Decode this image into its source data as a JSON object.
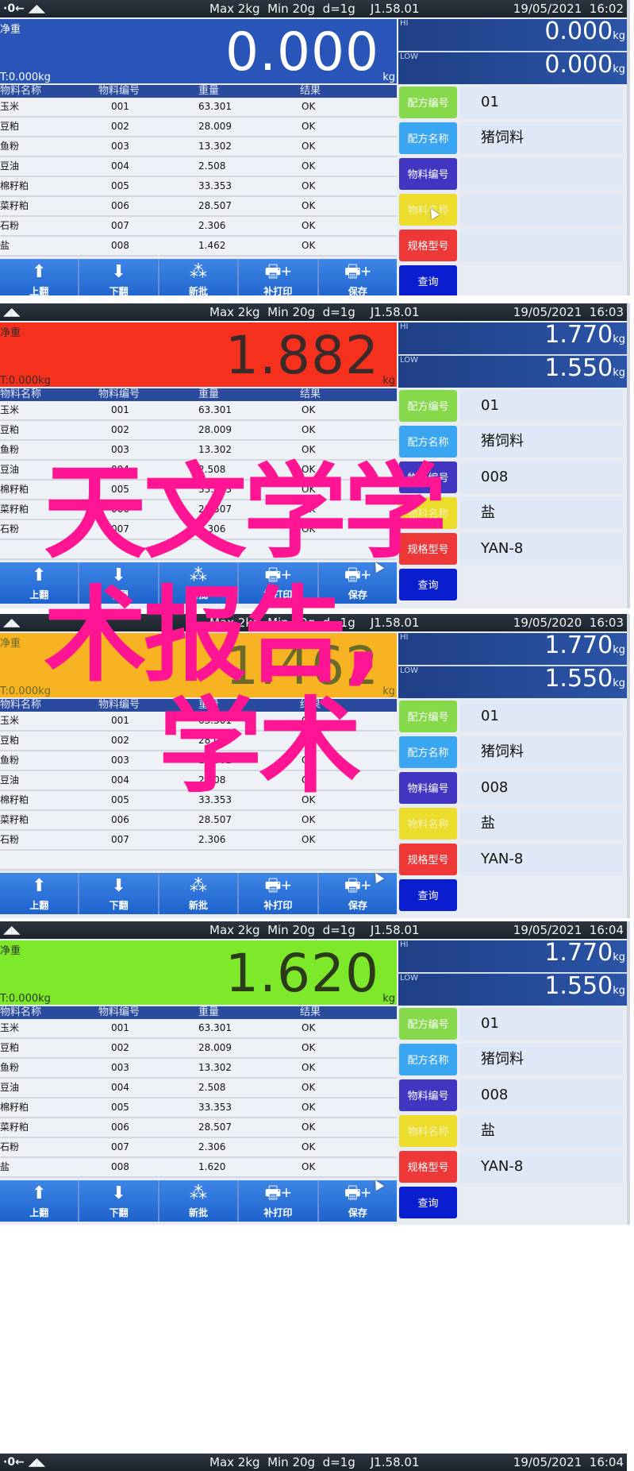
{
  "panels": [
    {
      "topbar": {
        "symbols": "·0← ◢◣",
        "specs": "Max 2kg  Min 20g  d=1g    J1.58.01",
        "datetime": "19/05/2021  16:02"
      },
      "weigh": {
        "net_label": "净重",
        "reading": "0.000",
        "tare": "T:0.000kg",
        "unit": "kg",
        "bg": "#2a55b8",
        "color": "#ffffff"
      },
      "hi": {
        "label": "HI",
        "value": "0.000",
        "unit": "kg"
      },
      "low": {
        "label": "LOW",
        "value": "0.000",
        "unit": "kg"
      },
      "rows": [
        [
          "玉米",
          "001",
          "63.301",
          "OK"
        ],
        [
          "豆粕",
          "002",
          "28.009",
          "OK"
        ],
        [
          "鱼粉",
          "003",
          "13.302",
          "OK"
        ],
        [
          "豆油",
          "004",
          "2.508",
          "OK"
        ],
        [
          "棉籽粕",
          "005",
          "33.353",
          "OK"
        ],
        [
          "菜籽粕",
          "006",
          "28.507",
          "OK"
        ],
        [
          "石粉",
          "007",
          "2.306",
          "OK"
        ],
        [
          "盐",
          "008",
          "1.462",
          "OK"
        ]
      ],
      "side_values": [
        "01",
        "猪饲料",
        "",
        "",
        ""
      ]
    },
    {
      "topbar": {
        "symbols": "◢◣",
        "specs": "Max 2kg  Min 20g  d=1g    J1.58.01",
        "datetime": "19/05/2021  16:03"
      },
      "weigh": {
        "net_label": "净重",
        "reading": "1.882",
        "tare": "T:0.000kg",
        "unit": "kg",
        "bg": "#f5311e",
        "color": "#3a2a2a"
      },
      "hi": {
        "label": "HI",
        "value": "1.770",
        "unit": "kg"
      },
      "low": {
        "label": "LOW",
        "value": "1.550",
        "unit": "kg"
      },
      "rows": [
        [
          "玉米",
          "001",
          "63.301",
          "OK"
        ],
        [
          "豆粕",
          "002",
          "28.009",
          "OK"
        ],
        [
          "鱼粉",
          "003",
          "13.302",
          "OK"
        ],
        [
          "豆油",
          "004",
          "2.508",
          "OK"
        ],
        [
          "棉籽粕",
          "005",
          "33.353",
          "OK"
        ],
        [
          "菜籽粕",
          "006",
          "28.507",
          "OK"
        ],
        [
          "石粉",
          "007",
          "2.306",
          "OK"
        ]
      ],
      "side_values": [
        "01",
        "猪饲料",
        "008",
        "盐",
        "YAN-8"
      ]
    },
    {
      "topbar": {
        "symbols": "◢◣",
        "specs": "Max 2kg  Min 20g  d=1g    J1.58.01",
        "datetime": "19/05/2020  16:03"
      },
      "weigh": {
        "net_label": "净重",
        "reading": "1.462",
        "tare": "T:0.000kg",
        "unit": "kg",
        "bg": "#f7b322",
        "color": "#6b6a2a"
      },
      "hi": {
        "label": "HI",
        "value": "1.770",
        "unit": "kg"
      },
      "low": {
        "label": "LOW",
        "value": "1.550",
        "unit": "kg"
      },
      "rows": [
        [
          "玉米",
          "001",
          "63.301",
          "OK"
        ],
        [
          "豆粕",
          "002",
          "28.009",
          "OK"
        ],
        [
          "鱼粉",
          "003",
          "13.302",
          "OK"
        ],
        [
          "豆油",
          "004",
          "2.508",
          "OK"
        ],
        [
          "棉籽粕",
          "005",
          "33.353",
          "OK"
        ],
        [
          "菜籽粕",
          "006",
          "28.507",
          "OK"
        ],
        [
          "石粉",
          "007",
          "2.306",
          "OK"
        ]
      ],
      "side_values": [
        "01",
        "猪饲料",
        "008",
        "盐",
        "YAN-8"
      ]
    },
    {
      "topbar": {
        "symbols": "◢◣",
        "specs": "Max 2kg  Min 20g  d=1g    J1.58.01",
        "datetime": "19/05/2021  16:04"
      },
      "weigh": {
        "net_label": "净重",
        "reading": "1.620",
        "tare": "T:0.000kg",
        "unit": "kg",
        "bg": "#7ee82a",
        "color": "#2a3a1a"
      },
      "hi": {
        "label": "HI",
        "value": "1.770",
        "unit": "kg"
      },
      "low": {
        "label": "LOW",
        "value": "1.550",
        "unit": "kg"
      },
      "rows": [
        [
          "玉米",
          "001",
          "63.301",
          "OK"
        ],
        [
          "豆粕",
          "002",
          "28.009",
          "OK"
        ],
        [
          "鱼粉",
          "003",
          "13.302",
          "OK"
        ],
        [
          "豆油",
          "004",
          "2.508",
          "OK"
        ],
        [
          "棉籽粕",
          "005",
          "33.353",
          "OK"
        ],
        [
          "菜籽粕",
          "006",
          "28.507",
          "OK"
        ],
        [
          "石粉",
          "007",
          "2.306",
          "OK"
        ],
        [
          "盐",
          "008",
          "1.620",
          "OK"
        ]
      ],
      "side_values": [
        "01",
        "猪饲料",
        "008",
        "盐",
        "YAN-8"
      ]
    }
  ],
  "table_headers": [
    "物料名称",
    "物料编号",
    "重量",
    "结果"
  ],
  "toolbar": [
    {
      "icon": "arrow-up-icon",
      "glyph": "⬆",
      "label": "上翻"
    },
    {
      "icon": "arrow-down-icon",
      "glyph": "⬇",
      "label": "下翻"
    },
    {
      "icon": "batch-icon",
      "glyph": "⁂",
      "label": "新批"
    },
    {
      "icon": "printer-plus-icon",
      "glyph": "🖶+",
      "label": "补打印"
    },
    {
      "icon": "printer-plus-icon",
      "glyph": "🖶+",
      "label": "保存"
    }
  ],
  "side_buttons": [
    {
      "label": "配方编号",
      "color": "#86d94a"
    },
    {
      "label": "配方名称",
      "color": "#3aa5f0"
    },
    {
      "label": "物料编号",
      "color": "#4036c2"
    },
    {
      "label": "物料名称",
      "color": "#ecdc2c"
    },
    {
      "label": "规格型号",
      "color": "#ee3838"
    },
    {
      "label": "查询",
      "color": "#0a1ed0"
    }
  ],
  "bottom_bar": {
    "symbols": "·0← ◢◣",
    "specs": "Max 2kg  Min 20g  d=1g    J1.58.01",
    "datetime": "19/05/2021  16:04"
  },
  "overlay_text": {
    "line1": "天文学学",
    "line2": "术报告,",
    "line3": "学术"
  }
}
